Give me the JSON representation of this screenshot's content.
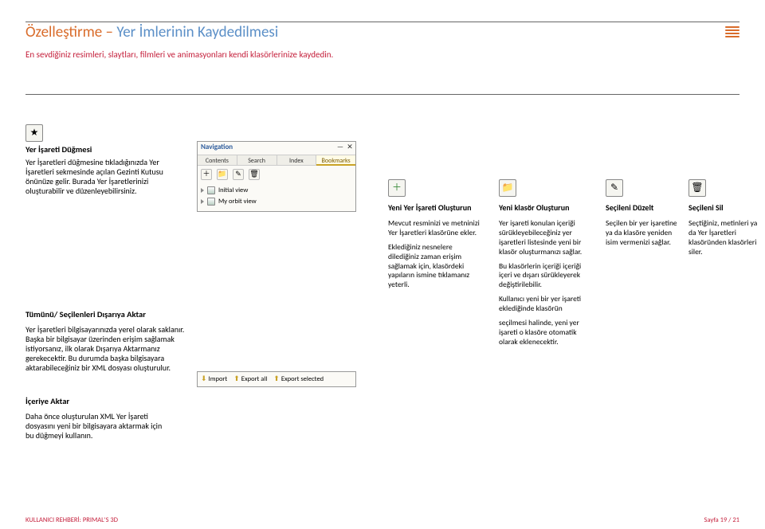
{
  "title_prefix": "Özelleştirme – ",
  "title_topic": "Yer İmlerinin Kaydedilmesi",
  "subtitle": "En sevdiğiniz resimleri, slaytları, filmleri ve animasyonları kendi klasörlerinize kaydedin.",
  "left": {
    "button_heading": "Yer İşareti Düğmesi",
    "button_body": "Yer İşaretleri düğmesine tıkladığınızda Yer İşaretleri sekmesinde açılan Gezinti Kutusu önünüze gelir. Burada Yer İşaretlerinizi oluşturabilir ve düzenleyebilirsiniz.",
    "export_heading": "Tümünü/ Seçilenleri Dışarıya Aktar",
    "export_body": "Yer İşaretleri bilgisayarınızda yerel olarak saklanır. Başka bir bilgisayar üzerinden erişim sağlamak istiyorsanız, ilk olarak Dışarıya Aktarmanız gerekecektir. Bu durumda başka bilgisayara aktarabileceğiniz bir XML dosyası oluşturulur.",
    "import_heading": "İçeriye Aktar",
    "import_body": "Daha önce oluşturulan XML Yer İşareti dosyasını yeni bir bilgisayara aktarmak için bu düğmeyi kullanın."
  },
  "panel": {
    "title": "Navigation",
    "min": "—",
    "close": "✕",
    "tabs": [
      "Contents",
      "Search",
      "Index",
      "Bookmarks"
    ],
    "row1": "Initial view",
    "row2": "My orbit view",
    "import": "Import",
    "export_all": "Export all",
    "export_sel": "Export selected"
  },
  "cols": {
    "a": {
      "h": "Yeni Yer İşareti Oluşturun",
      "p1": "Mevcut resminizi ve metninizi Yer İşaretleri klasörüne ekler.",
      "p2": "Eklediğiniz nesnelere dilediğiniz zaman erişim sağlamak için, klasördeki yapıların ismine tıklamanız yeterli."
    },
    "b": {
      "h": "Yeni klasör Oluşturun",
      "p1": "Yer işareti konulan içeriği sürükleyebileceğiniz yer işaretleri listesinde yeni bir klasör oluşturmanızı sağlar.",
      "p2": "Bu klasörlerin içeriği içeriği içeri ve dışarı sürükleyerek değiştirilebilir.",
      "p3": "Kullanıcı yeni bir yer işareti eklediğinde klasörün",
      "p4": "seçilmesi halinde, yeni yer işareti o klasöre otomatik olarak eklenecektir."
    },
    "c": {
      "h": "Seçileni Düzelt",
      "p1": "Seçilen bir yer işaretine ya da klasöre yeniden isim vermenizi sağlar."
    },
    "d": {
      "h": "Seçileni Sil",
      "p1": "Seçtiğiniz, metinleri ya da Yer İşaretleri klasöründen klasörleri siler."
    }
  },
  "footer": {
    "left": "KULLANICI REHBERİ: PRIMAL'S 3D",
    "right": "Sayfa 19 / 21"
  }
}
